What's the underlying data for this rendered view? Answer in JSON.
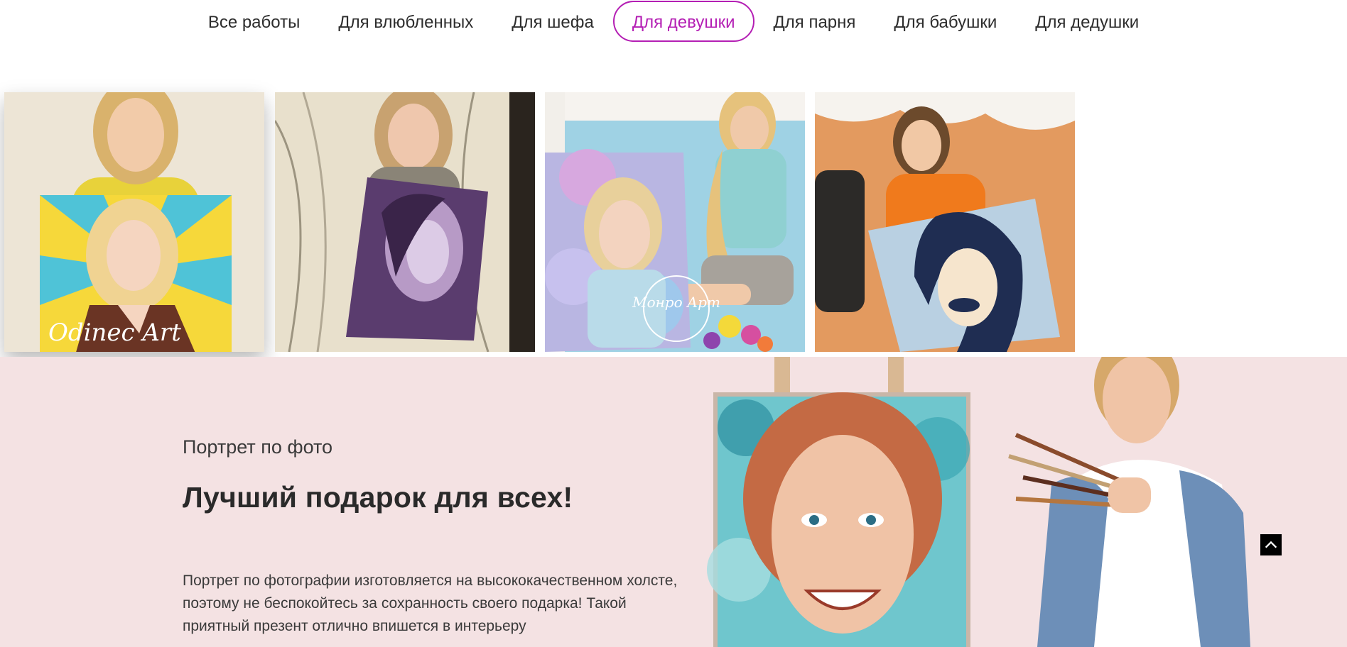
{
  "filters": {
    "items": [
      {
        "label": "Все работы"
      },
      {
        "label": "Для влюбленных"
      },
      {
        "label": "Для шефа"
      },
      {
        "label": "Для девушки"
      },
      {
        "label": "Для парня"
      },
      {
        "label": "Для бабушки"
      },
      {
        "label": "Для дедушки"
      }
    ],
    "active": "Для девушки"
  },
  "gallery": {
    "watermarks": {
      "photo1": "Odinec Art",
      "photo3": "Монро Арт"
    }
  },
  "promo": {
    "subtitle": "Портрет по фото",
    "title": "Лучший подарок для всех!",
    "text": "Портрет по фотографии изготовляется на высококачественном холсте, поэтому не беспокойтесь за сохранность своего подарка! Такой приятный презент отлично впишется в интерьеру"
  },
  "colors": {
    "accent": "#b41fb4",
    "promo_background": "#f4e2e3"
  },
  "icons": {
    "scroll_top": "chevron-up-icon"
  }
}
